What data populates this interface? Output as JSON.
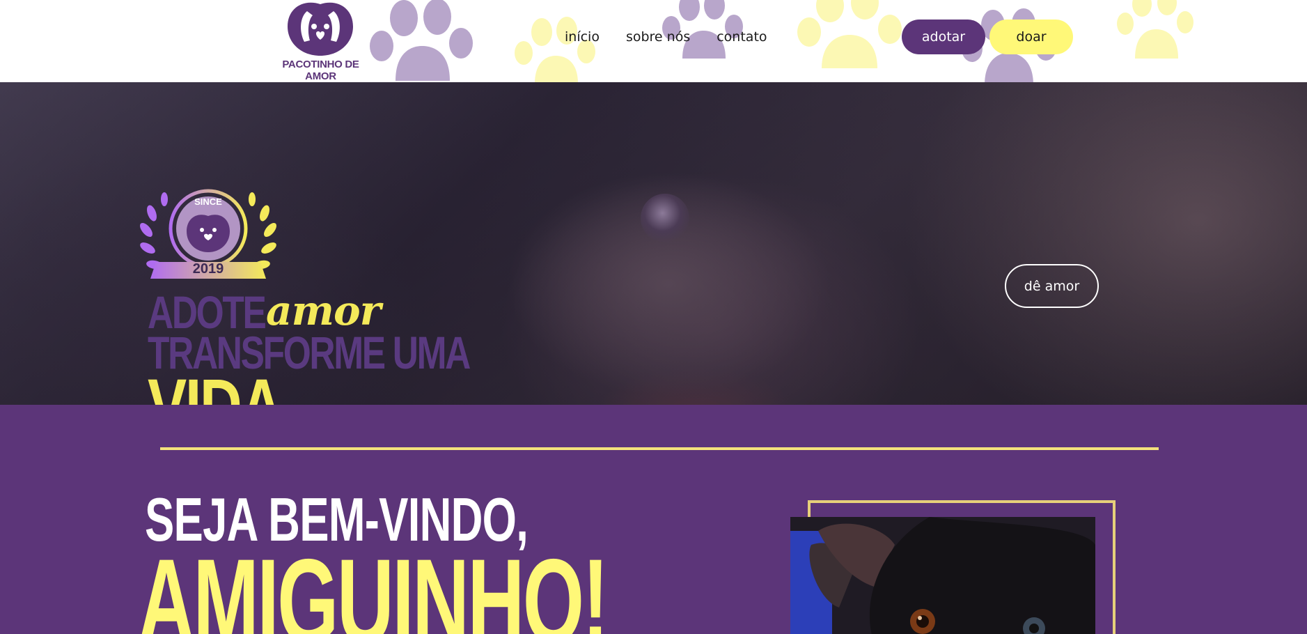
{
  "brand": {
    "name": "PACOTINHO DE AMOR",
    "purple": "#5c3579",
    "yellow": "#fff878",
    "lilac": "#b8a6cb"
  },
  "nav": {
    "items": [
      {
        "label": "início"
      },
      {
        "label": "sobre nós"
      },
      {
        "label": "contato"
      }
    ]
  },
  "header": {
    "adotar_label": "adotar",
    "doar_label": "doar"
  },
  "hero": {
    "badge_since": "SINCE",
    "badge_year": "2019",
    "slogan_adote": "ADOTE",
    "slogan_amor": "amor",
    "slogan_transforme": "TRANSFORME UMA",
    "slogan_vida": "VIDA",
    "cta_label": "dê amor"
  },
  "welcome": {
    "line1": "SEJA BEM-VINDO,",
    "line2": "AMIGUINHO!"
  }
}
